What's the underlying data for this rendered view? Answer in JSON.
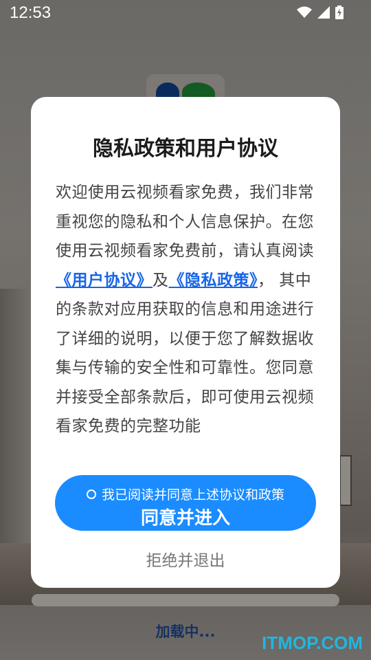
{
  "statusbar": {
    "time": "12:53",
    "icons": [
      "wifi-icon",
      "cell-signal-icon",
      "battery-charging-icon"
    ]
  },
  "dialog": {
    "title": "隐私政策和用户协议",
    "body_intro": "欢迎使用云视频看家免费，我们非常重视您的隐私和个人信息保护。在您使用云视频看家免费前，请认真阅读",
    "user_agreement_link": "《用户协议》",
    "and_text": "及",
    "privacy_policy_link": "《隐私政策》",
    "body_rest": "， 其中的条款对应用获取的信息和用途进行了详细的说明，以便于您了解数据收集与传输的安全性和可靠性。您同意并接受全部条款后，即可使用云视频看家免费的完整功能",
    "consent_checkbox_label": "我已阅读并同意上述协议和政策",
    "agree_button_label": "同意并进入",
    "reject_button_label": "拒绝并退出"
  },
  "loading": {
    "text": "加载中..."
  },
  "watermark": {
    "text": "ITMOP.COM"
  },
  "colors": {
    "primary_button": "#1a8cff",
    "link": "#1565e8",
    "loading_text": "#17305f",
    "watermark": "#1fb7e0"
  }
}
